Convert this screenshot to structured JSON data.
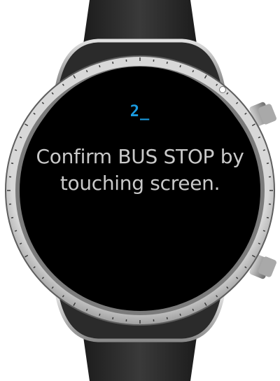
{
  "screen": {
    "code": "2_",
    "message": "Confirm BUS STOP by touching screen."
  },
  "colors": {
    "screen_background": "#000000",
    "code_text": "#1a9be0",
    "message_text": "#c9c9c9",
    "strap": "#2a2a2a",
    "bezel": "#9a9a9a",
    "crown": "#8c8c8c"
  },
  "icons": {
    "top_indicator": "status-dot-icon"
  }
}
